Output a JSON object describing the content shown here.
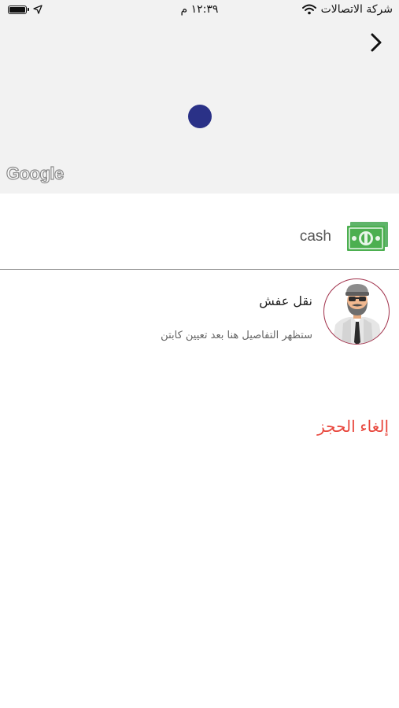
{
  "status_bar": {
    "carrier": "شركة الاتصالات",
    "time": "١٢:٣٩ م",
    "battery_level": 1.0
  },
  "map": {
    "attribution": "Google"
  },
  "payment": {
    "method_label": "cash",
    "icon": "cash-icon"
  },
  "driver": {
    "name": "نقل عفش",
    "note": "ستظهر التفاصيل هنا بعد تعيين كابتن",
    "avatar_icon": "driver-avatar"
  },
  "actions": {
    "cancel_label": "إلغاء الحجز"
  },
  "colors": {
    "pin": "#2a3187",
    "cancel": "#e8463c",
    "cash_green": "#4caf50",
    "avatar_border": "#a0304a"
  }
}
